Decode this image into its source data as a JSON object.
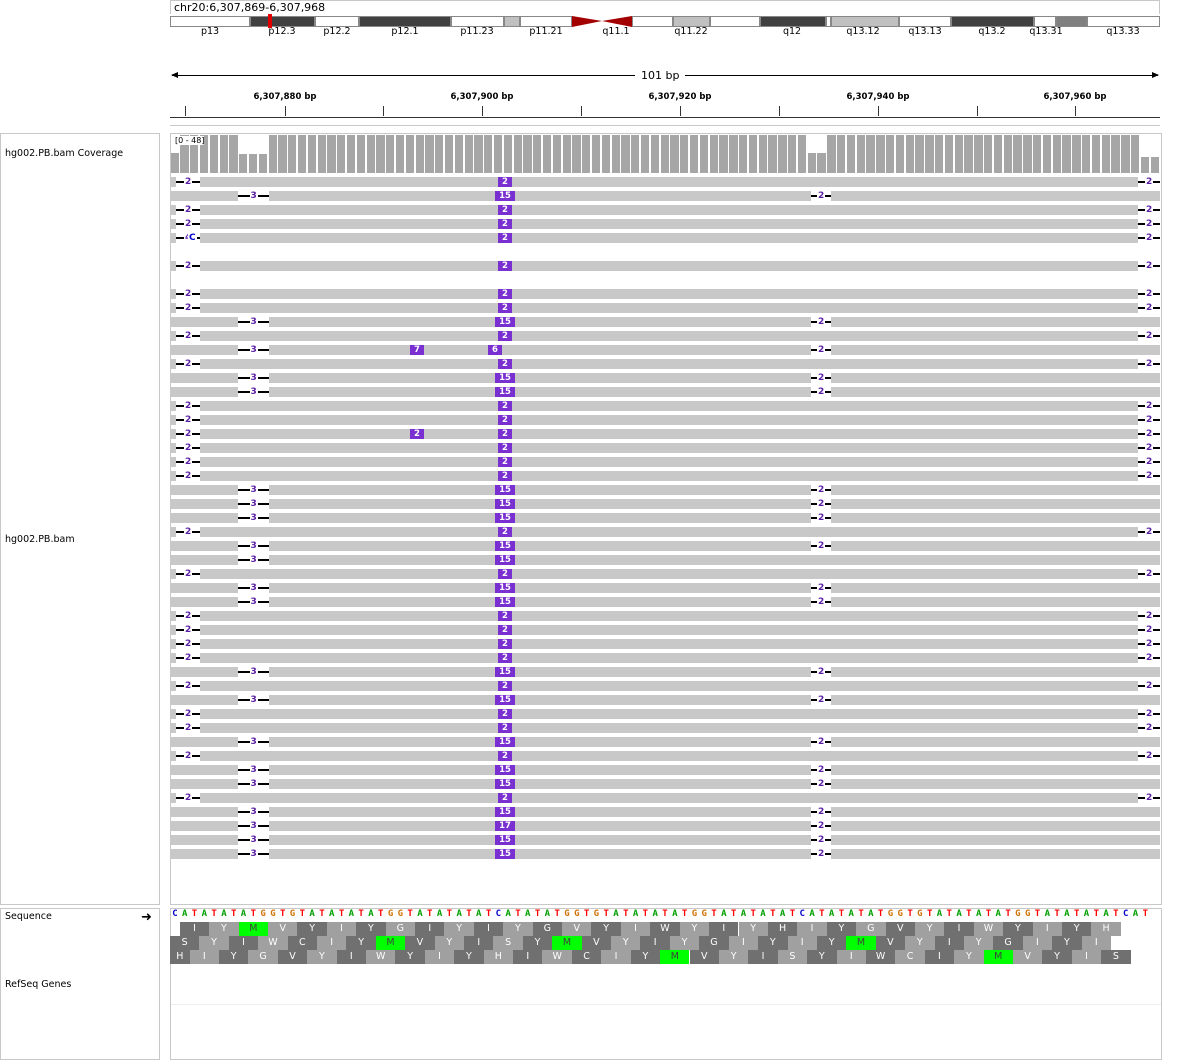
{
  "locus": "chr20:6,307,869-6,307,968",
  "span_label": "101 bp",
  "ideogram_bands": [
    {
      "name": "p13",
      "color": "#ffffff"
    },
    {
      "name": "p12.3",
      "color": "#404040"
    },
    {
      "name": "p12.2",
      "color": "#ffffff"
    },
    {
      "name": "p12.1",
      "color": "#404040"
    },
    {
      "name": "p11.23",
      "color": "#ffffff"
    },
    {
      "name": "",
      "color": "#c0c0c0"
    },
    {
      "name": "p11.21",
      "color": "#ffffff"
    },
    {
      "name": "q11.1",
      "color": "#a30000"
    },
    {
      "name": "",
      "color": "#ffffff"
    },
    {
      "name": "q11.22",
      "color": "#c0c0c0"
    },
    {
      "name": "",
      "color": "#ffffff"
    },
    {
      "name": "q12",
      "color": "#404040"
    },
    {
      "name": "",
      "color": "#ffffff"
    },
    {
      "name": "q13.12",
      "color": "#c0c0c0"
    },
    {
      "name": "q13.13",
      "color": "#ffffff"
    },
    {
      "name": "q13.2",
      "color": "#404040"
    },
    {
      "name": "",
      "color": "#ffffff"
    },
    {
      "name": "q13.31",
      "color": "#808080"
    },
    {
      "name": "q13.33",
      "color": "#ffffff"
    }
  ],
  "ruler_labels": [
    "6,307,880 bp",
    "6,307,900 bp",
    "6,307,920 bp",
    "6,307,940 bp",
    "6,307,960 bp"
  ],
  "tracks": {
    "coverage_name": "hg002.PB.bam Coverage",
    "coverage_range": "[0 - 48]",
    "alignment_name": "hg002.PB.bam",
    "sequence_name": "Sequence",
    "genes_name": "RefSeq Genes"
  },
  "reads": [
    {
      "l": "2",
      "m": "2",
      "r": "2"
    },
    {
      "l": "3",
      "m": "15",
      "r": "2",
      "long": true
    },
    {
      "l": "2",
      "m": "2",
      "r": "2"
    },
    {
      "l": "2",
      "m": "2",
      "r": "2"
    },
    {
      "l": "4",
      "c": "C",
      "m": "2",
      "r": "2"
    },
    {
      "empty": true
    },
    {
      "l": "2",
      "m": "2",
      "r": "2"
    },
    {
      "empty": true
    },
    {
      "l": "2",
      "m": "2",
      "r": "2"
    },
    {
      "l": "2",
      "m": "2",
      "r": "2"
    },
    {
      "l": "3",
      "m": "15",
      "r": "2",
      "long": true
    },
    {
      "l": "2",
      "m": "2",
      "r": "2"
    },
    {
      "l": "3",
      "x": "7",
      "m": "6",
      "r": "2",
      "long": true
    },
    {
      "l": "2",
      "m": "2",
      "r": "2"
    },
    {
      "l": "3",
      "m": "15",
      "r": "2",
      "long": true
    },
    {
      "l": "3",
      "m": "15",
      "r": "2",
      "long": true
    },
    {
      "l": "2",
      "m": "2",
      "r": "2"
    },
    {
      "l": "2",
      "m": "2",
      "r": "2"
    },
    {
      "l": "2",
      "x": "2",
      "m": "2",
      "r": "2"
    },
    {
      "l": "2",
      "m": "2",
      "r": "2"
    },
    {
      "l": "2",
      "m": "2",
      "r": "2"
    },
    {
      "l": "2",
      "m": "2",
      "r": "2"
    },
    {
      "l": "3",
      "m": "15",
      "r": "2",
      "long": true
    },
    {
      "l": "3",
      "m": "15",
      "r": "2",
      "long": true
    },
    {
      "l": "3",
      "m": "15",
      "r": "2",
      "long": true
    },
    {
      "l": "2",
      "m": "2",
      "r": "2"
    },
    {
      "l": "3",
      "m": "15",
      "r": "2",
      "long": true
    },
    {
      "l": "3",
      "m": "15",
      "long": true
    },
    {
      "l": "2",
      "m": "2",
      "r": "2"
    },
    {
      "l": "3",
      "m": "15",
      "r": "2",
      "long": true
    },
    {
      "l": "3",
      "m": "15",
      "r": "2",
      "long": true
    },
    {
      "l": "2",
      "m": "2",
      "r": "2"
    },
    {
      "l": "2",
      "m": "2",
      "r": "2"
    },
    {
      "l": "2",
      "m": "2",
      "r": "2"
    },
    {
      "l": "2",
      "m": "2",
      "r": "2"
    },
    {
      "l": "3",
      "m": "15",
      "r": "2",
      "long": true
    },
    {
      "l": "2",
      "m": "2",
      "r": "2"
    },
    {
      "l": "3",
      "m": "15",
      "r": "2",
      "long": true
    },
    {
      "l": "2",
      "m": "2",
      "r": "2"
    },
    {
      "l": "2",
      "m": "2",
      "r": "2"
    },
    {
      "l": "3",
      "m": "15",
      "r": "2",
      "long": true
    },
    {
      "l": "2",
      "m": "2",
      "r": "2"
    },
    {
      "l": "3",
      "m": "15",
      "r": "2",
      "long": true
    },
    {
      "l": "3",
      "m": "15",
      "r": "2",
      "long": true
    },
    {
      "l": "2",
      "m": "2",
      "r": "2"
    },
    {
      "l": "3",
      "m": "15",
      "r": "2",
      "long": true
    },
    {
      "l": "3",
      "m": "17",
      "r": "2",
      "long": true
    },
    {
      "l": "3",
      "m": "15",
      "r": "2",
      "long": true
    },
    {
      "l": "3",
      "m": "15",
      "r": "2",
      "long": true
    }
  ],
  "sequence": "CATATATATGGTGTATATATATGGTATATATATCATATATGGTGTATATATATGGTATATATATCATATATATGGTGTATATATATGGTATATATATCAT",
  "base_colors": {
    "A": "#00a000",
    "C": "#0000c8",
    "G": "#d17105",
    "T": "#ff0000"
  },
  "translation_frames": [
    [
      "I",
      "Y",
      "M",
      "V",
      "Y",
      "I",
      "Y",
      "G",
      "I",
      "Y",
      "I",
      "Y",
      "G",
      "V",
      "Y",
      "I",
      "W",
      "Y",
      "I",
      "Y",
      "H",
      "I",
      "Y",
      "G",
      "V",
      "Y",
      "I",
      "W",
      "Y",
      "I",
      "Y",
      "H"
    ],
    [
      "S",
      "Y",
      "I",
      "W",
      "C",
      "I",
      "Y",
      "M",
      "V",
      "Y",
      "I",
      "S",
      "Y",
      "M",
      "V",
      "Y",
      "I",
      "Y",
      "G",
      "I",
      "Y",
      "I",
      "Y",
      "M",
      "V",
      "Y",
      "I",
      "Y",
      "G",
      "I",
      "Y",
      "I"
    ],
    [
      "H",
      "I",
      "Y",
      "G",
      "V",
      "Y",
      "I",
      "W",
      "Y",
      "I",
      "Y",
      "H",
      "I",
      "W",
      "C",
      "I",
      "Y",
      "M",
      "V",
      "Y",
      "I",
      "S",
      "Y",
      "I",
      "W",
      "C",
      "I",
      "Y",
      "M",
      "V",
      "Y",
      "I",
      "S"
    ]
  ],
  "colors": {
    "methionine": "#00ff00",
    "aa_dark": "#707070",
    "aa_light": "#a0a0a0",
    "insertion": "#7a2fd0",
    "read": "#c8c8c8",
    "coverage": "#a6a6a6"
  }
}
